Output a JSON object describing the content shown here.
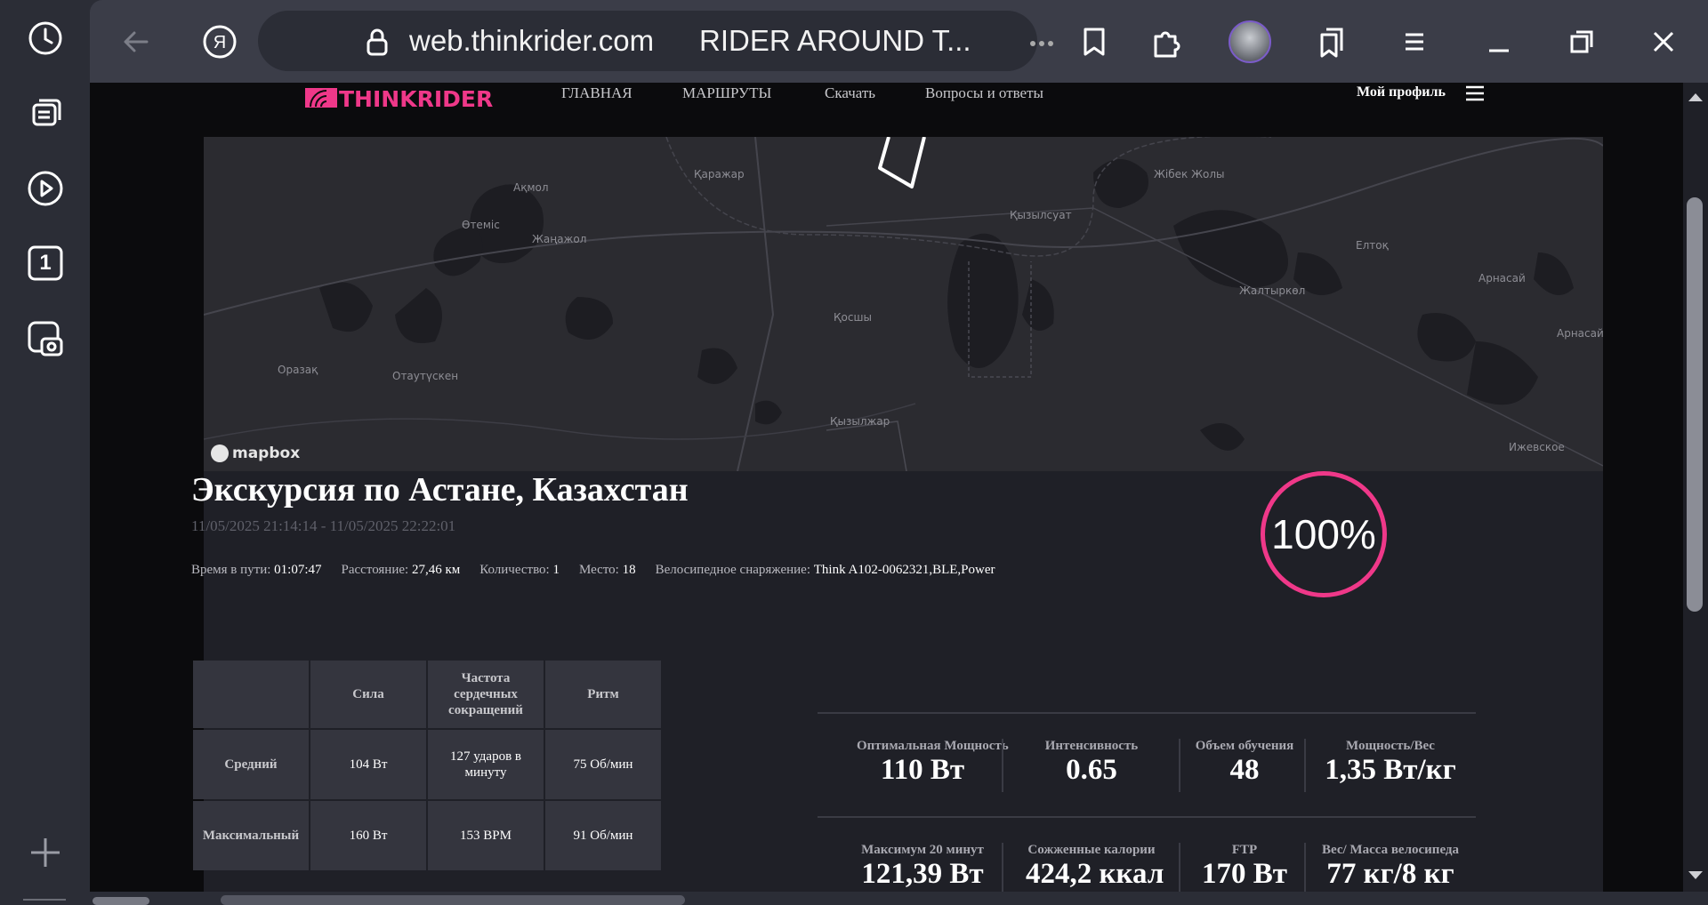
{
  "browser": {
    "url": "web.thinkrider.com",
    "tab_title": "RIDER AROUND T...",
    "side_badge": "1"
  },
  "site": {
    "logo_text": "THINKRIDER",
    "nav": [
      "ГЛАВНАЯ",
      "МАРШРУТЫ",
      "Скачать",
      "Вопросы и ответы"
    ],
    "profile": "Мой профиль"
  },
  "map": {
    "attribution": "mapbox",
    "labels": [
      "Қаражар",
      "Ақмол",
      "Өтеміс",
      "Жаңажол",
      "Қызылсуат",
      "Жібек Жолы",
      "Елтоқ",
      "Арнасай",
      "Жалтыркөл",
      "Арнасай",
      "Қосшы",
      "Оразақ",
      "Отаутүскен",
      "Қызылжар",
      "Ижевское"
    ]
  },
  "ride": {
    "title": "Экскурсия по Астане, Казахстан",
    "dates": "11/05/2025 21:14:14 - 11/05/2025 22:22:01",
    "completion": "100%",
    "completion_value": 100,
    "meta": [
      {
        "key": "Время в пути:",
        "value": "01:07:47"
      },
      {
        "key": "Расстояние:",
        "value": "27,46 км"
      },
      {
        "key": "Количество:",
        "value": "1"
      },
      {
        "key": "Место:",
        "value": "18"
      },
      {
        "key": "Велосипедное снаряжение:",
        "value": "Think A102-0062321,BLE,Power"
      }
    ]
  },
  "table": {
    "headers": [
      "",
      "Сила",
      "Частота сердечных сокращений",
      "Ритм"
    ],
    "rows": [
      {
        "label": "Средний",
        "cells": [
          "104 Вт",
          "127 ударов в минуту",
          "75 Об/мин"
        ]
      },
      {
        "label": "Максимальный",
        "cells": [
          "160 Вт",
          "153 BPM",
          "91 Об/мин"
        ]
      }
    ]
  },
  "metrics": {
    "row1": [
      {
        "label": "Оптимальная Мощность",
        "value": "110 Вт"
      },
      {
        "label": "Интенсивность",
        "value": "0.65"
      },
      {
        "label": "Объем обучения",
        "value": "48"
      },
      {
        "label": "Мощность/Вес",
        "value": "1,35 Вт/кг"
      }
    ],
    "row2": [
      {
        "label": "Максимум 20 минут",
        "value": "121,39 Вт"
      },
      {
        "label": "Сожженные калории",
        "value": "424,2 ккал"
      },
      {
        "label": "FTP",
        "value": "170 Вт"
      },
      {
        "label": "Вес/ Масса велосипеда",
        "value": "77 кг/8 кг"
      }
    ]
  },
  "colors": {
    "accent": "#ef3889",
    "page_bg": "#0b0b0d",
    "card_bg": "#1f2027",
    "map_bg": "#2b2b30"
  }
}
